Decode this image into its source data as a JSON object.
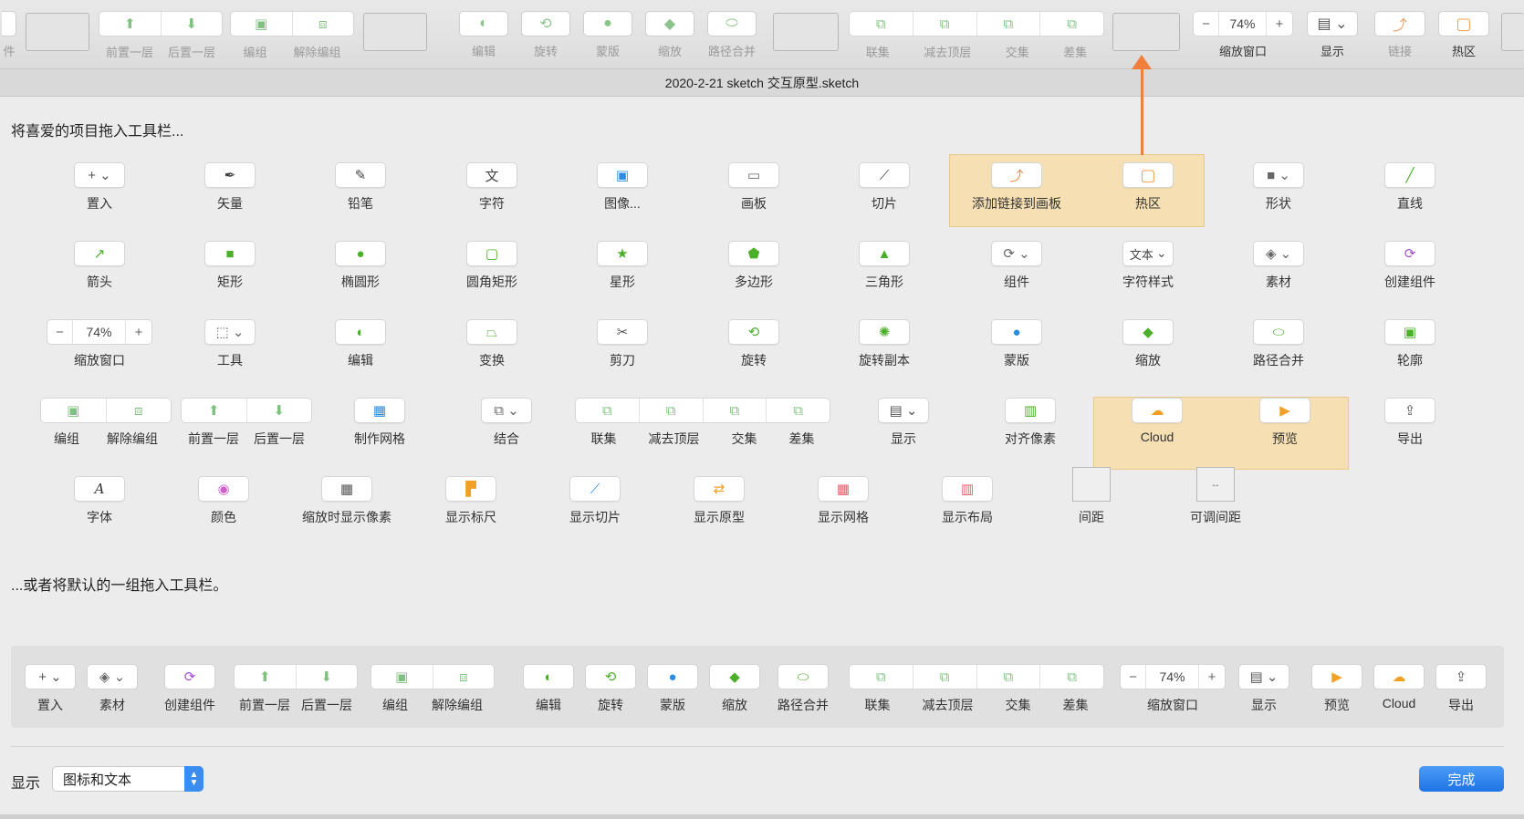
{
  "toolbar": {
    "items": [
      {
        "label": "件",
        "icon": "partial-icon"
      },
      {
        "label": "前置一层",
        "icon": "bring-forward-icon"
      },
      {
        "label": "后置一层",
        "icon": "send-backward-icon"
      },
      {
        "label": "编组",
        "icon": "group-icon"
      },
      {
        "label": "解除编组",
        "icon": "ungroup-icon"
      },
      {
        "label": "编辑",
        "icon": "edit-icon"
      },
      {
        "label": "旋转",
        "icon": "rotate-icon"
      },
      {
        "label": "蒙版",
        "icon": "mask-icon"
      },
      {
        "label": "缩放",
        "icon": "scale-icon"
      },
      {
        "label": "路径合并",
        "icon": "flatten-icon"
      },
      {
        "label": "联集",
        "icon": "union-icon"
      },
      {
        "label": "减去顶层",
        "icon": "subtract-icon"
      },
      {
        "label": "交集",
        "icon": "intersect-icon"
      },
      {
        "label": "差集",
        "icon": "difference-icon"
      },
      {
        "label": "缩放窗口",
        "zoom_value": "74%"
      },
      {
        "label": "显示",
        "icon": "view-icon"
      },
      {
        "label": "链接",
        "icon": "link-icon"
      },
      {
        "label": "热区",
        "icon": "hotspot-icon"
      }
    ]
  },
  "window": {
    "title": "2020-2-21 sketch 交互原型.sketch"
  },
  "customize": {
    "heading": "将喜爱的项目拖入工具栏...",
    "rows": [
      [
        "置入",
        "矢量",
        "铅笔",
        "字符",
        "图像...",
        "画板",
        "切片",
        "添加链接到画板",
        "热区",
        "形状",
        "直线"
      ],
      [
        "箭头",
        "矩形",
        "椭圆形",
        "圆角矩形",
        "星形",
        "多边形",
        "三角形",
        "组件",
        "字符样式",
        "素材",
        "创建组件"
      ],
      [
        "缩放窗口",
        "工具",
        "编辑",
        "变换",
        "剪刀",
        "旋转",
        "旋转副本",
        "蒙版",
        "缩放",
        "路径合并",
        "轮廓"
      ],
      [
        "编组",
        "解除编组",
        "前置一层",
        "后置一层",
        "制作网格",
        "结合",
        "联集",
        "减去顶层",
        "交集",
        "差集",
        "显示",
        "对齐像素",
        "Cloud",
        "预览",
        "导出"
      ],
      [
        "字体",
        "颜色",
        "缩放时显示像素",
        "显示标尺",
        "显示切片",
        "显示原型",
        "显示网格",
        "显示布局",
        "间距",
        "可调间距"
      ]
    ],
    "zoom_value": "74%",
    "text_style_button": "文本"
  },
  "default_set": {
    "heading": "...或者将默认的一组拖入工具栏。",
    "items": [
      "置入",
      "素材",
      "创建组件",
      "前置一层",
      "后置一层",
      "编组",
      "解除编组",
      "编辑",
      "旋转",
      "蒙版",
      "缩放",
      "路径合并",
      "联集",
      "减去顶层",
      "交集",
      "差集",
      "缩放窗口",
      "显示",
      "预览",
      "Cloud",
      "导出"
    ],
    "zoom_value": "74%"
  },
  "footer": {
    "show_label": "显示",
    "show_value": "图标和文本",
    "done_label": "完成"
  },
  "colors": {
    "accent_blue": "#1f74e4",
    "highlight": "#f5dfb3",
    "arrow": "#f07e3c",
    "icon_green": "#4caf2a"
  }
}
